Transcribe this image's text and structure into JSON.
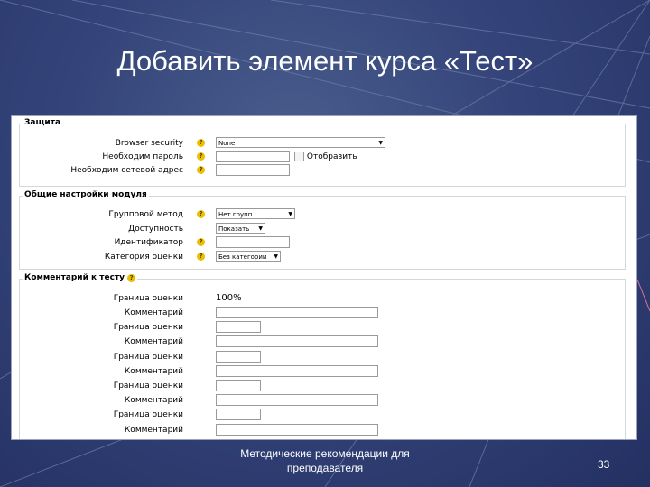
{
  "slide": {
    "title": "Добавить элемент курса «Тест»",
    "footer_line1": "Методические рекомендации для",
    "footer_line2": "преподавателя",
    "page_number": "33"
  },
  "security": {
    "legend": "Защита",
    "browser_security_label": "Browser security",
    "browser_security_value": "None",
    "password_label": "Необходим пароль",
    "show_label": "Отобразить",
    "network_label": "Необходим сетевой адрес"
  },
  "common": {
    "legend": "Общие настройки модуля",
    "group_mode_label": "Групповой метод",
    "group_mode_value": "Нет групп",
    "visibility_label": "Доступность",
    "visibility_value": "Показать",
    "id_label": "Идентификатор",
    "grade_category_label": "Категория оценки",
    "grade_category_value": "Без категории"
  },
  "feedback": {
    "legend": "Комментарий к тесту",
    "boundary_label": "Граница оценки",
    "first_boundary_value": "100%",
    "comment_label": "Комментарий",
    "rows": [
      "Комментарий",
      "Граница оценки",
      "Комментарий",
      "Граница оценки",
      "Комментарий",
      "Граница оценки",
      "Комментарий",
      "Граница оценки",
      "Комментарий"
    ]
  },
  "icons": {
    "help": "help-icon",
    "dropdown": "chevron-down-icon"
  },
  "colors": {
    "background": "#34447a",
    "help_icon": "#e8c000"
  }
}
